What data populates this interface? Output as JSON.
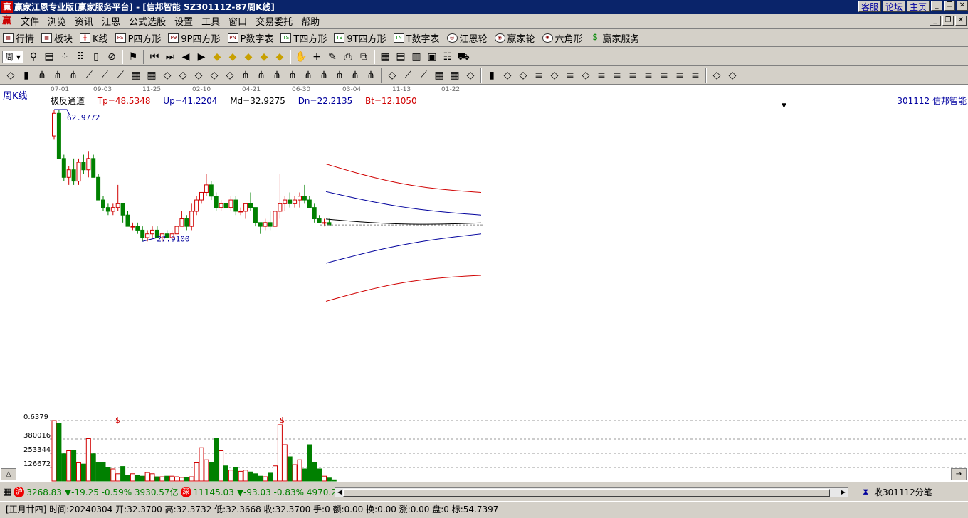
{
  "window": {
    "title": "赢家江恩专业版[赢家服务平台] - [信邦智能   SZ301112-87周K线]",
    "links": [
      "客服",
      "论坛",
      "主页"
    ]
  },
  "menu": {
    "items": [
      "文件",
      "浏览",
      "资讯",
      "江恩",
      "公式选股",
      "设置",
      "工具",
      "窗口",
      "交易委托",
      "帮助"
    ]
  },
  "toolbar1": {
    "items": [
      {
        "label": "行情",
        "icon": "grid-icon"
      },
      {
        "label": "板块",
        "icon": "blocks-icon"
      },
      {
        "label": "K线",
        "icon": "candle-icon"
      },
      {
        "label": "P四方形",
        "icon": "ps-icon",
        "badge": "PS"
      },
      {
        "label": "9P四方形",
        "icon": "p9-icon",
        "badge": "P9"
      },
      {
        "label": "P数字表",
        "icon": "pn-icon",
        "badge": "PN"
      },
      {
        "label": "T四方形",
        "icon": "ts-icon",
        "badge": "TS"
      },
      {
        "label": "9T四方形",
        "icon": "t9-icon",
        "badge": "T9"
      },
      {
        "label": "T数字表",
        "icon": "tn-icon",
        "badge": "TN"
      },
      {
        "label": "江恩轮",
        "icon": "wheel-icon"
      },
      {
        "label": "赢家轮",
        "icon": "wheel2-icon"
      },
      {
        "label": "六角形",
        "icon": "hexagon-icon"
      },
      {
        "label": "赢家服务",
        "icon": "dollar-icon"
      }
    ]
  },
  "toolbar2": {
    "period": "周",
    "icons": [
      "zoom-icon",
      "copy-icon",
      "grid-dot-icon",
      "dots-icon",
      "period-icon",
      "stop-icon",
      "flag-icon",
      "first-icon",
      "last-icon",
      "prev-icon",
      "next-icon",
      "diamond1-icon",
      "diamond2-icon",
      "diamond3-icon",
      "diamond4-icon",
      "diamond5-icon",
      "hand-icon",
      "cross-icon",
      "pen-icon",
      "printer-icon",
      "copy2-icon",
      "calendar-icon",
      "calc-icon",
      "table-icon",
      "save-icon",
      "group-icon",
      "truck-icon"
    ]
  },
  "toolbar3": {
    "icons": [
      "pencil-icon",
      "bars-icon",
      "fork-icon",
      "fork2-icon",
      "fork3-icon",
      "fan-icon",
      "fan2-icon",
      "fan3-icon",
      "circle-grid-icon",
      "grid-lines-icon",
      "angle-icon",
      "triangle-icon",
      "target-icon",
      "sun-icon",
      "snow-icon",
      "fork4-icon",
      "fork5-icon",
      "fork6-icon",
      "fork7-icon",
      "fork8-icon",
      "fork9-icon",
      "fork10-icon",
      "fork11-icon",
      "fork12-icon",
      "cross2-icon",
      "fan4-icon",
      "fan5-icon",
      "grid2-icon",
      "grid3-icon",
      "lines-icon",
      "bars2-icon",
      "scissor-icon",
      "percent-icon",
      "levels-icon",
      "coin-icon",
      "levels2-icon",
      "rocket-icon",
      "levels3-icon",
      "levels4-icon",
      "levels5-icon",
      "levels6-icon",
      "levels7-icon",
      "levels8-icon",
      "levels9-icon",
      "yinyang-icon",
      "infinity-icon"
    ]
  },
  "chart": {
    "period_label": "周K线",
    "date_labels": [
      "07-01",
      "09-03",
      "11-25",
      "02-10",
      "04-21",
      "06-30",
      "03-04",
      "11-13",
      "01-22"
    ],
    "indicator": {
      "name": "极反通道",
      "tp": "Tp=48.5348",
      "up": "Up=41.2204",
      "md": "Md=32.9275",
      "dn": "Dn=22.2135",
      "bt": "Bt=12.1050"
    },
    "stock": "301112  信邦智能",
    "high_label": "62.9772",
    "low_label": "27.9100",
    "volume_ticks": [
      "0.6379",
      "380016",
      "253344",
      "126672"
    ],
    "markers": [
      "$",
      "$"
    ],
    "colors": {
      "up": "#d00000",
      "down": "#008000",
      "channel_outer": "#d00000",
      "channel_inner": "#00009c",
      "mid": "#000000"
    }
  },
  "chart_data": {
    "type": "candlestick",
    "title": "信邦智能 周K线",
    "ohlc": [
      [
        56,
        63,
        55,
        62
      ],
      [
        62,
        63,
        50,
        50
      ],
      [
        50,
        51,
        44,
        45
      ],
      [
        45,
        48,
        43,
        47
      ],
      [
        47,
        50,
        43,
        44
      ],
      [
        44,
        50,
        43,
        49
      ],
      [
        49,
        51,
        46,
        47
      ],
      [
        47,
        52,
        45,
        50
      ],
      [
        50,
        51,
        45,
        45
      ],
      [
        45,
        46,
        39,
        39
      ],
      [
        39,
        40,
        36,
        37
      ],
      [
        37,
        38,
        35,
        36
      ],
      [
        36,
        38,
        35,
        37
      ],
      [
        37,
        43,
        36,
        38
      ],
      [
        38,
        38,
        33,
        35
      ],
      [
        35,
        36,
        32,
        32
      ],
      [
        32,
        33,
        31,
        32
      ],
      [
        32,
        33,
        30,
        31
      ],
      [
        31,
        32,
        28,
        29
      ],
      [
        29,
        31,
        28,
        30
      ],
      [
        30,
        32,
        29,
        31
      ],
      [
        31,
        32,
        29,
        29
      ],
      [
        29,
        30,
        28,
        30
      ],
      [
        30,
        31,
        29,
        29
      ],
      [
        29,
        31,
        29,
        30
      ],
      [
        30,
        33,
        29,
        32
      ],
      [
        32,
        36,
        32,
        34
      ],
      [
        34,
        35,
        31,
        32
      ],
      [
        32,
        38,
        31,
        36
      ],
      [
        36,
        40,
        35,
        39
      ],
      [
        39,
        41,
        38,
        41
      ],
      [
        41,
        46,
        40,
        43
      ],
      [
        43,
        44,
        39,
        40
      ],
      [
        40,
        41,
        36,
        37
      ],
      [
        37,
        39,
        36,
        38
      ],
      [
        38,
        39,
        36,
        37
      ],
      [
        37,
        40,
        36,
        39
      ],
      [
        39,
        40,
        35,
        36
      ],
      [
        36,
        37,
        35,
        36
      ],
      [
        36,
        38,
        34,
        38
      ],
      [
        38,
        41,
        36,
        37
      ],
      [
        37,
        37,
        32,
        33
      ],
      [
        33,
        33,
        30,
        32
      ],
      [
        32,
        34,
        31,
        33
      ],
      [
        33,
        36,
        31,
        32
      ],
      [
        32,
        36,
        31,
        36
      ],
      [
        36,
        46,
        34,
        38
      ],
      [
        38,
        40,
        36,
        39
      ],
      [
        39,
        41,
        37,
        38
      ],
      [
        38,
        40,
        37,
        39
      ],
      [
        39,
        41,
        37,
        40
      ],
      [
        40,
        43,
        38,
        39
      ],
      [
        39,
        40,
        37,
        37
      ],
      [
        37,
        38,
        33,
        34
      ],
      [
        34,
        35,
        33,
        33
      ],
      [
        33,
        34,
        32,
        33
      ],
      [
        33,
        34,
        32.3,
        32.37
      ]
    ],
    "volume_scale": [
      0,
      126672,
      253344,
      380016
    ],
    "channel": {
      "tp": [
        48.5348,
        41
      ],
      "up": [
        41.2204,
        35
      ],
      "md": [
        32.9275,
        32.9275
      ],
      "dn": [
        22.2135,
        30
      ],
      "bt": [
        12.105,
        19
      ]
    },
    "ylim": [
      12,
      63
    ]
  },
  "bottom": {
    "sh_index": "3268.83",
    "sh_change": "▼-19.25 -0.59% 3930.57亿",
    "sz_index": "11145.03",
    "sz_change": "▼-93.03 -0.83% 4970.2",
    "ticker": "收301112分笔"
  },
  "status": {
    "text": "[正月廿四] 时间:20240304 开:32.3700 高:32.3732 低:32.3668 收:32.3700 手:0 额:0.00 换:0.00 涨:0.00 盘:0 标:54.7397"
  }
}
